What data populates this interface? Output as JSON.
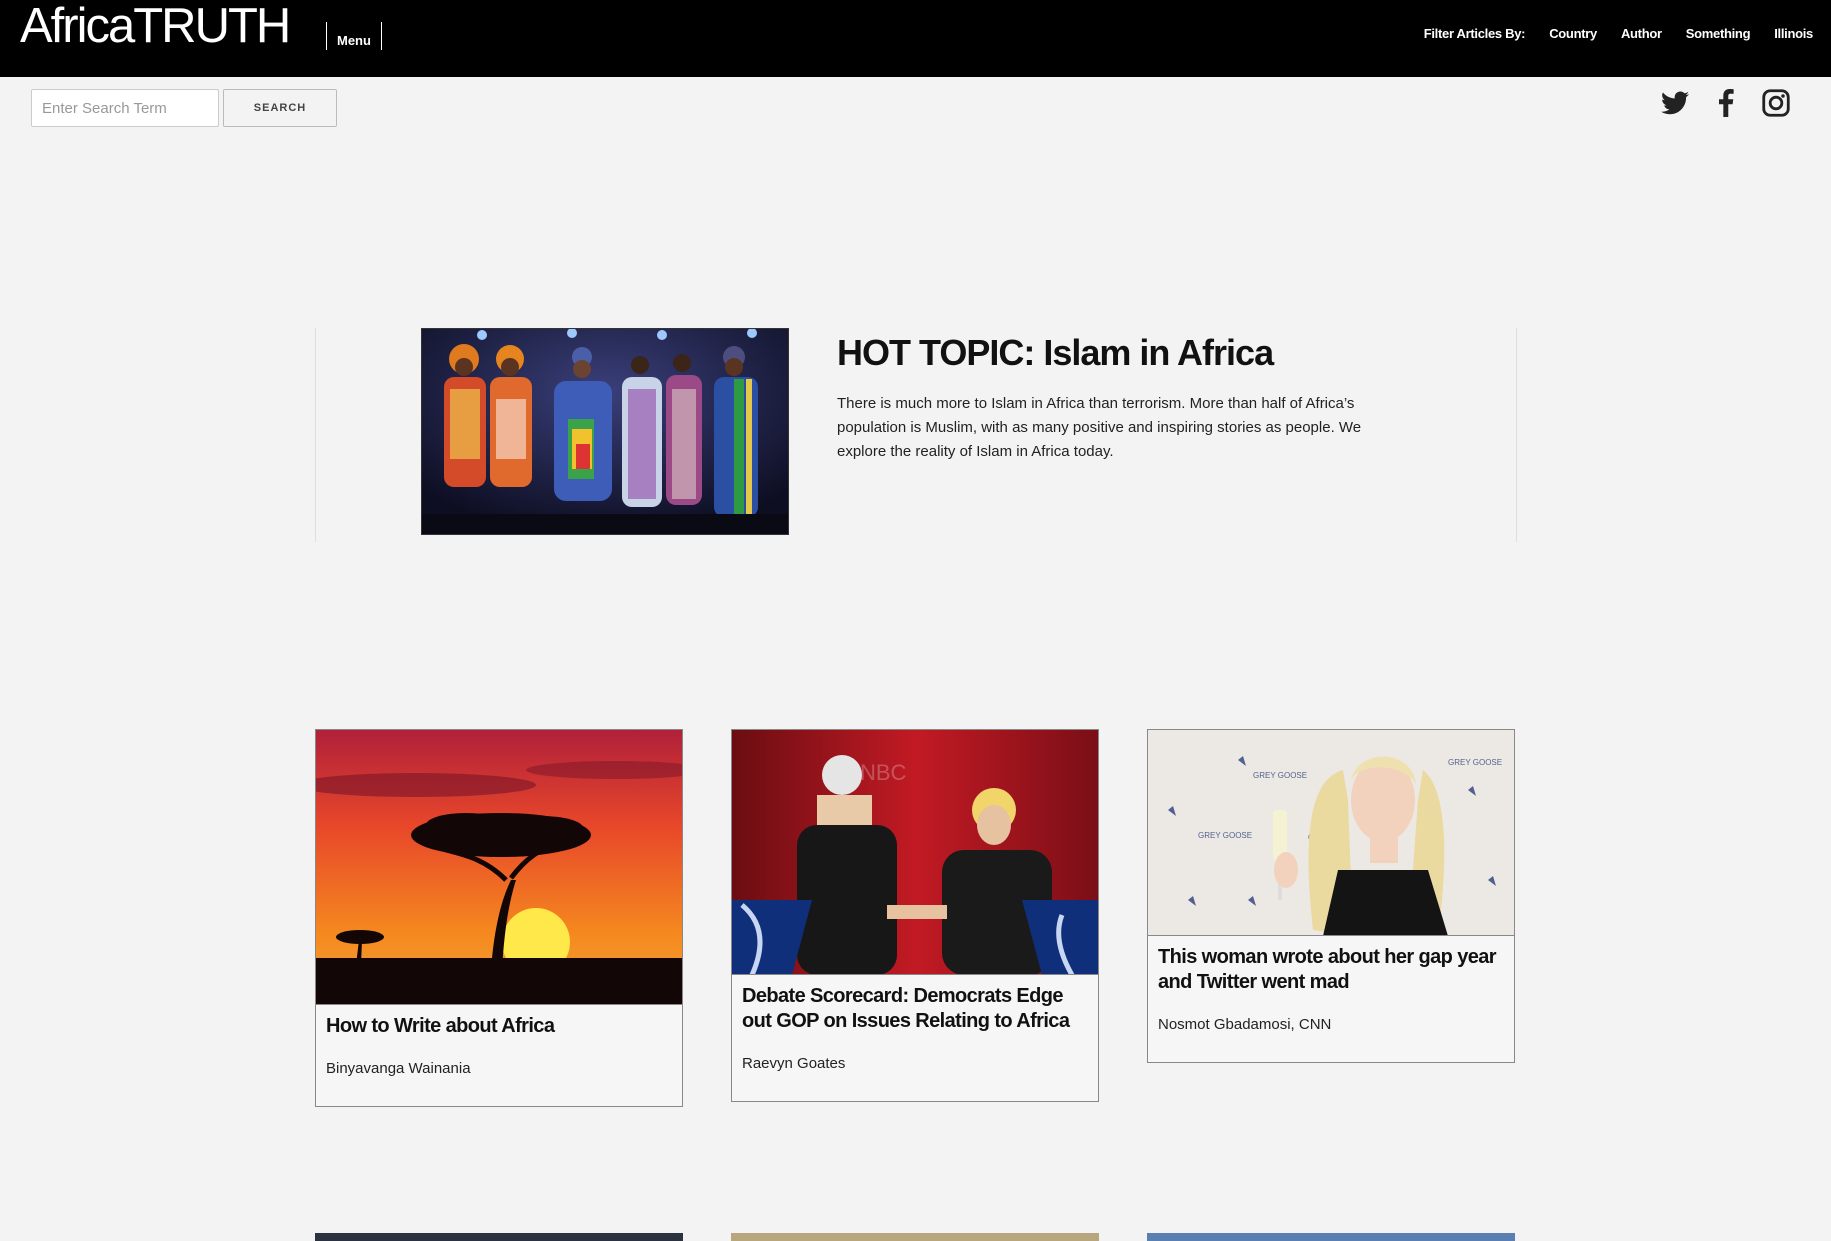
{
  "header": {
    "brand": "AfricaTRUTH",
    "menu_label": "Menu",
    "filter_label": "Filter Articles By:",
    "filters": [
      "Country",
      "Author",
      "Something",
      "Illinois"
    ]
  },
  "search": {
    "placeholder": "Enter Search Term",
    "button_label": "SEARCH"
  },
  "social": [
    "twitter-icon",
    "facebook-icon",
    "instagram-icon"
  ],
  "hot_topic": {
    "title": "HOT TOPIC: Islam in Africa",
    "text": "There is much more to Islam in Africa than terrorism. More than half of Africa’s population is Muslim, with as many positive and inspiring stories as people. We explore the reality of Islam in Africa today."
  },
  "articles": [
    {
      "title": "How to Write about Africa",
      "author": "Binyavanga Wainania"
    },
    {
      "title": "Debate Scorecard: Democrats Edge out GOP on Issues Relating to Africa",
      "author": "Raevyn Goates"
    },
    {
      "title": "This woman wrote about her gap year and Twitter went mad",
      "author": "Nosmot Gbadamosi, CNN"
    }
  ],
  "colors": {
    "header_bg": "#000000",
    "page_bg": "#f3f3f3",
    "text": "#111111"
  }
}
